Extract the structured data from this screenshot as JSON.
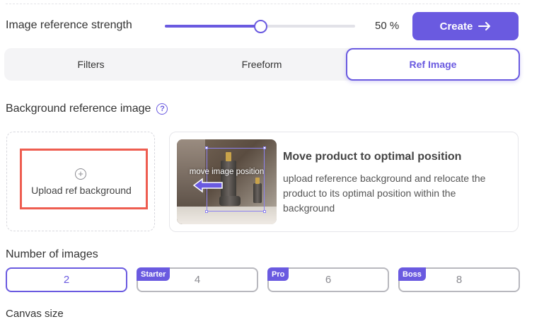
{
  "strength": {
    "label": "Image reference strength",
    "value": 50,
    "value_text": "50 %",
    "accent": "#6a5ae0"
  },
  "create_button": {
    "label": "Create",
    "icon": "arrow-right-icon"
  },
  "tabs": [
    {
      "label": "Filters",
      "active": false
    },
    {
      "label": "Freeform",
      "active": false
    },
    {
      "label": "Ref Image",
      "active": true
    }
  ],
  "background_ref": {
    "label": "Background reference image",
    "help_icon": "question-circle-icon",
    "upload_label": "Upload ref background",
    "upload_icon": "plus-circle-icon",
    "highlight_color": "#ee5d50",
    "preview_caption": "move image position",
    "card_title": "Move product to optimal position",
    "card_description": "upload reference background and relocate the product to its optimal position within the background"
  },
  "number_of_images": {
    "label": "Number of images",
    "options": [
      {
        "value": "2",
        "badge": "",
        "selected": true
      },
      {
        "value": "4",
        "badge": "Starter",
        "selected": false
      },
      {
        "value": "6",
        "badge": "Pro",
        "selected": false
      },
      {
        "value": "8",
        "badge": "Boss",
        "selected": false
      }
    ]
  },
  "canvas_size": {
    "label": "Canvas size"
  }
}
